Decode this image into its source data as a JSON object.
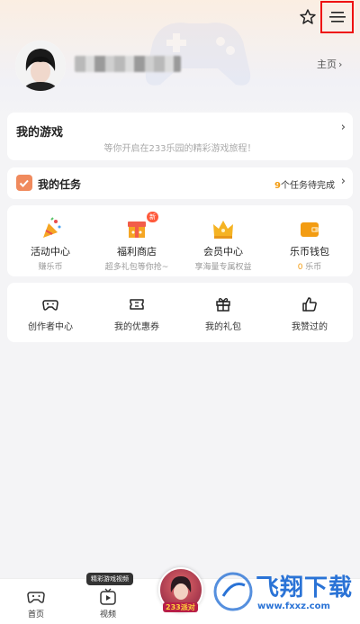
{
  "header": {
    "homepage_label": "主页"
  },
  "my_games": {
    "title": "我的游戏",
    "subtitle": "等你开启在233乐园的精彩游戏旅程！"
  },
  "tasks": {
    "title": "我的任务",
    "count": "9",
    "count_suffix": "个任务待完成"
  },
  "features": [
    {
      "label": "活动中心",
      "sub": "赚乐币",
      "icon": "party-popper-icon"
    },
    {
      "label": "福利商店",
      "sub": "超多礼包等你抢~",
      "icon": "gift-shop-icon",
      "badge": "新"
    },
    {
      "label": "会员中心",
      "sub": "享海量专属权益",
      "icon": "crown-icon"
    },
    {
      "label": "乐币钱包",
      "sub_num": "0",
      "sub_suffix": "乐币",
      "icon": "wallet-icon"
    }
  ],
  "tools": [
    {
      "label": "创作者中心",
      "icon": "gamepad-icon"
    },
    {
      "label": "我的优惠券",
      "icon": "ticket-icon"
    },
    {
      "label": "我的礼包",
      "icon": "gift-icon"
    },
    {
      "label": "我赞过的",
      "icon": "thumbs-up-icon"
    }
  ],
  "bottom_nav": {
    "home_label": "首页",
    "video_label": "视频",
    "video_tip": "精彩游戏视频",
    "center_game_label": "233派对"
  },
  "watermark": {
    "title": "飞翔下载",
    "url": "www.fxxz.com"
  },
  "colors": {
    "accent_orange": "#f39c12",
    "highlight_red": "#e11"
  }
}
